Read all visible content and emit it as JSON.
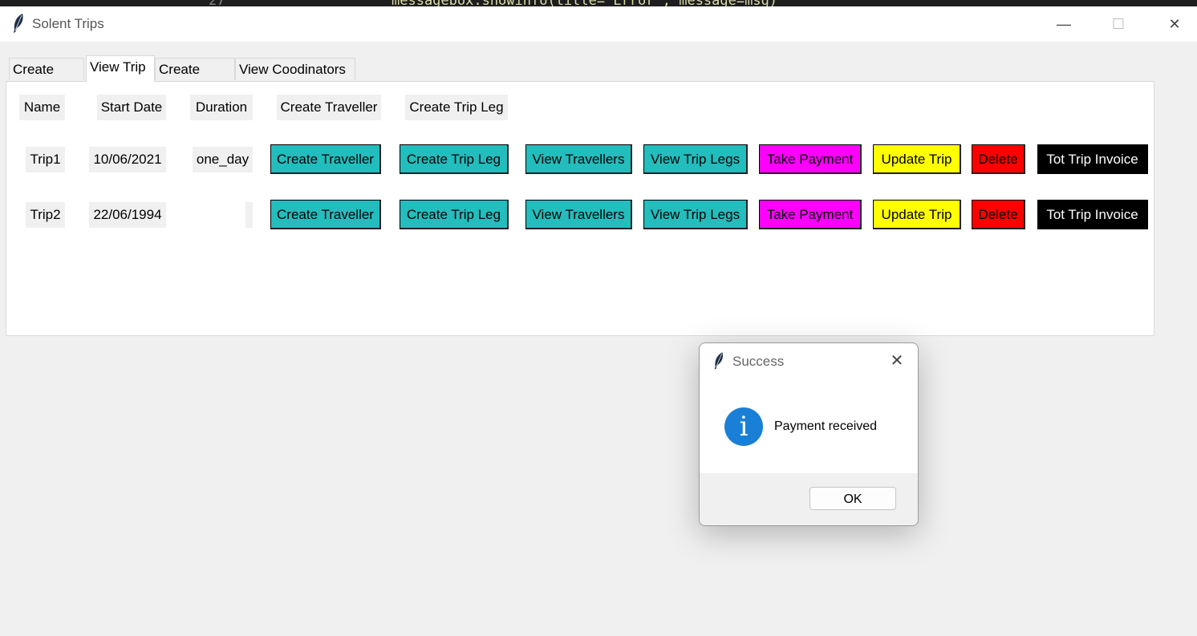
{
  "editor": {
    "line_number": "27",
    "code": "messagebox.showinfo(title='Error', message=msg)"
  },
  "window": {
    "title": "Solent Trips",
    "min_glyph": "—",
    "max_glyph": "☐",
    "close_glyph": "✕"
  },
  "tabs": [
    "Create Trip",
    "View Trip",
    "Create User",
    "View Coodinators"
  ],
  "headers": [
    "Name",
    "Start Date",
    "Duration",
    "Create Traveller",
    "Create Trip Leg"
  ],
  "rows": [
    {
      "name": "Trip1",
      "start_date": "10/06/2021",
      "duration": "one_day"
    },
    {
      "name": "Trip2",
      "start_date": "22/06/1994",
      "duration": ""
    }
  ],
  "row_buttons": {
    "create_traveller": "Create Traveller",
    "create_trip_leg": "Create Trip Leg",
    "view_travellers": "View Travellers",
    "view_trip_legs": "View Trip Legs",
    "take_payment": "Take Payment",
    "update_trip": "Update Trip",
    "delete": "Delete",
    "tot_trip_invoice": "Tot Trip Invoice"
  },
  "colors": {
    "teal": "#23bdbd",
    "magenta": "#ff00ff",
    "yellow": "#ffff00",
    "red": "#ff0000",
    "black": "#000000"
  },
  "dialog": {
    "title": "Success",
    "message": "Payment received",
    "ok_label": "OK",
    "close_glyph": "✕",
    "icon": "info-icon",
    "icon_glyph": "i"
  }
}
